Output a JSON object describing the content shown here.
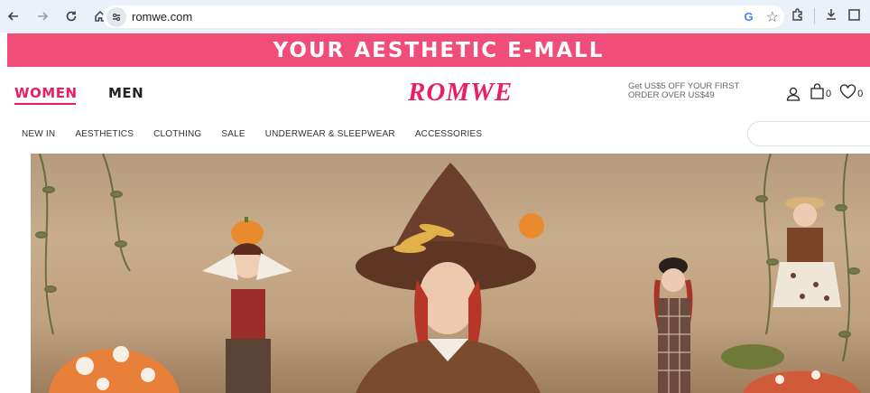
{
  "browser": {
    "url": "romwe.com",
    "back_icon": "back-arrow-icon",
    "forward_icon": "forward-arrow-icon",
    "reload_icon": "reload-icon",
    "home_icon": "home-icon",
    "site_info_icon": "site-settings-icon",
    "google_icon_label": "G",
    "bookmark_icon": "star-icon",
    "extensions_icon": "puzzle-icon",
    "download_icon": "download-icon"
  },
  "promo_banner": {
    "text": "YOUR AESTHETIC E-MALL",
    "color": "#f04d78"
  },
  "header": {
    "gender_tabs": [
      {
        "label": "WOMEN",
        "active": true
      },
      {
        "label": "MEN",
        "active": false
      }
    ],
    "logo": "ROMWE",
    "offer_text": "Get US$5 OFF YOUR FIRST ORDER OVER US$49",
    "cart_count": "0",
    "wishlist_count": "0",
    "brand_color": "#e91e63"
  },
  "category_nav": {
    "items": [
      "NEW IN",
      "AESTHETICS",
      "CLOTHING",
      "SALE",
      "UNDERWEAR & SLEEPWEAR",
      "ACCESSORIES"
    ]
  },
  "hero": {
    "theme": "autumn-witch-photoshoot"
  }
}
